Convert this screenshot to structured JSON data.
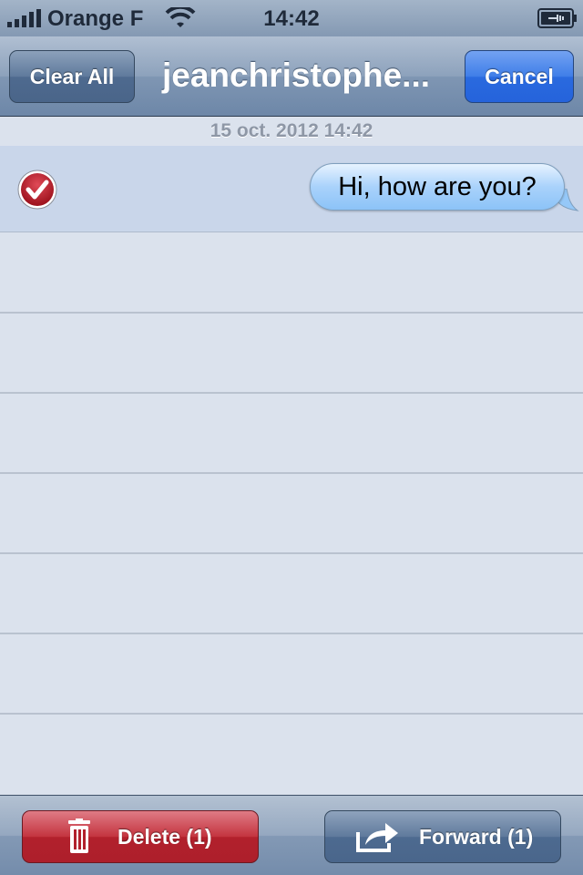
{
  "status_bar": {
    "carrier": "Orange F",
    "time": "14:42",
    "signal_icon": "signal-bars-icon",
    "wifi_icon": "wifi-icon",
    "battery_icon": "battery-charging-icon"
  },
  "nav": {
    "clear_all_label": "Clear All",
    "title": "jeanchristophe...",
    "cancel_label": "Cancel"
  },
  "conversation": {
    "date_header": "15 oct. 2012 14:42",
    "messages": [
      {
        "text": "Hi, how are you?",
        "selected": true,
        "direction": "outgoing"
      }
    ]
  },
  "toolbar": {
    "delete_label": "Delete (1)",
    "forward_label": "Forward (1)",
    "delete_icon": "trash-icon",
    "forward_icon": "forward-arrow-icon"
  },
  "colors": {
    "selection": "#c9d6ea",
    "delete": "#b2202c",
    "cancel": "#2a6adf"
  }
}
